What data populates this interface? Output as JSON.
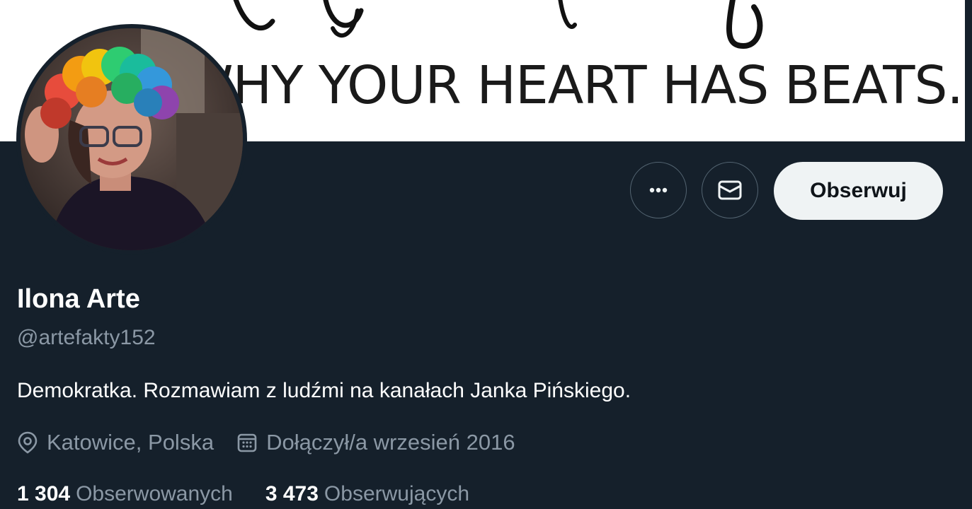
{
  "banner": {
    "text": "T WHY YOUR HEART HAS BEATS."
  },
  "actions": {
    "more_icon": "more-horizontal-icon",
    "message_icon": "envelope-icon",
    "follow_label": "Obserwuj"
  },
  "profile": {
    "display_name": "Ilona Arte",
    "handle": "@artefakty152",
    "bio": "Demokratka. Rozmawiam z ludźmi na kanałach Janka Pińskiego.",
    "location": "Katowice, Polska",
    "joined": "Dołączył/a wrzesień 2016",
    "following_count": "1 304",
    "following_label": "Obserwowanych",
    "followers_count": "3 473",
    "followers_label": "Obserwujących"
  },
  "colors": {
    "background": "#15202b",
    "text_primary": "#ffffff",
    "text_secondary": "#8b98a5",
    "follow_button_bg": "#eff3f4"
  }
}
